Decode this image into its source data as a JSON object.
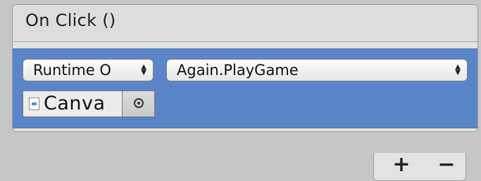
{
  "event": {
    "title": "On Click ()"
  },
  "listener": {
    "runtime": {
      "value": "Runtime O",
      "arrow_icon": "up-down-arrows-icon"
    },
    "function": {
      "value": "Again.PlayGame",
      "arrow_icon": "up-down-arrows-icon"
    },
    "object": {
      "value": "Canva",
      "type_icon": "script-icon",
      "picker_icon": "object-picker-icon"
    }
  },
  "footer": {
    "add_label": "+",
    "remove_label": "−"
  }
}
